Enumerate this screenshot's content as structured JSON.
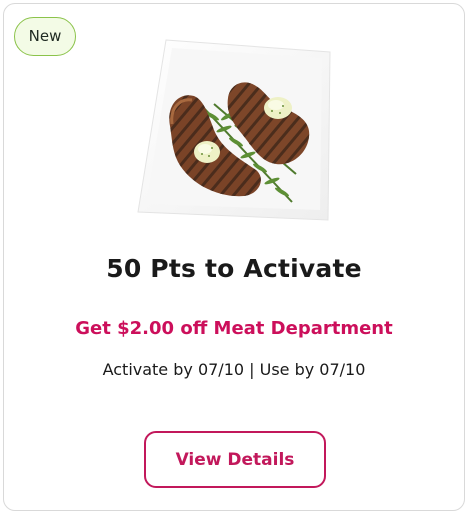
{
  "badge": {
    "label": "New"
  },
  "offer_card": {
    "image_icon": "grilled-steak-on-plate",
    "headline": "50 Pts to Activate",
    "offer_text": "Get $2.00 off Meat Department",
    "dates": "Activate by 07/10 | Use by 07/10",
    "button_label": "View Details"
  },
  "colors": {
    "accent": "#c2185b",
    "offer_text": "#cc0f5b",
    "badge_border": "#8bc34a",
    "badge_bg": "#f3fbe6"
  }
}
